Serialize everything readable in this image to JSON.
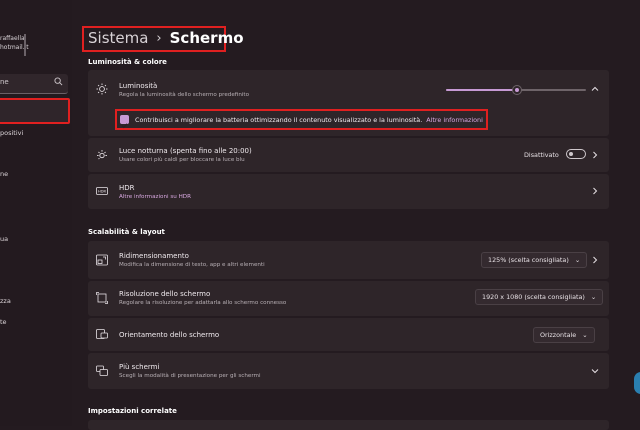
{
  "sidebar": {
    "account_line1": "raffaella",
    "account_line2": "hotmail.it",
    "search_text": "ne",
    "items": [
      "positivi",
      "ne",
      "ua",
      "zza",
      "te"
    ]
  },
  "header": {
    "section": "Sistema",
    "separator": "›",
    "page": "Schermo"
  },
  "sections": {
    "brightness": "Luminosità & colore",
    "scale": "Scalabilità & layout",
    "related": "Impostazioni correlate"
  },
  "brightness": {
    "title": "Luminosità",
    "subtitle": "Regola la luminosità dello schermo predefinito",
    "level_pct": 51,
    "checkbox_label": "Contribuisci a migliorare la batteria ottimizzando il contenuto visualizzato e la luminosità.",
    "checkbox_link": "Altre informazioni"
  },
  "night_light": {
    "title": "Luce notturna (spenta fino alle 20:00)",
    "subtitle": "Usare colori più caldi per bloccare la luce blu",
    "state": "Disattivato"
  },
  "hdr": {
    "title": "HDR",
    "link": "Altre informazioni su HDR"
  },
  "scale": {
    "title": "Ridimensionamento",
    "subtitle": "Modifica la dimensione di testo, app e altri elementi",
    "value": "125% (scelta consigliata)"
  },
  "resolution": {
    "title": "Risoluzione dello schermo",
    "subtitle": "Regolare la risoluzione per adattarla allo schermo connesso",
    "value": "1920 x 1080 (scelta consigliata)"
  },
  "orientation": {
    "title": "Orientamento dello schermo",
    "value": "Orizzontale"
  },
  "multi": {
    "title": "Più schermi",
    "subtitle": "Scegli la modalità di presentazione per gli schermi"
  },
  "colors": {
    "accent": "#c79ad4",
    "highlight": "#e02020"
  }
}
